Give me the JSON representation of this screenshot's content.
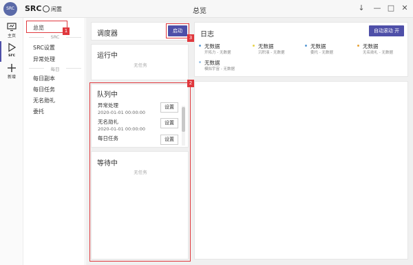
{
  "titlebar": {
    "logo_text": "SRC",
    "app_name": "SRC",
    "status": "闲置",
    "window_title": "总览",
    "buttons": {
      "pin": "↓",
      "minimize": "—",
      "maximize": "□",
      "close": "✕"
    }
  },
  "rail": {
    "items": [
      {
        "label": "主页",
        "icon": "monitor-icon"
      },
      {
        "label": "src",
        "icon": "play-icon"
      },
      {
        "label": "新增",
        "icon": "plus-icon"
      }
    ]
  },
  "menu": {
    "overview": "总览",
    "group_src": "SRC",
    "src_settings": "SRC设置",
    "error_handling": "异常处理",
    "group_daily": "每日",
    "daily_dungeon": "每日副本",
    "daily_tasks": "每日任务",
    "nameless_honor": "无名勋礼",
    "commission": "委托"
  },
  "scheduler": {
    "title": "调度器",
    "start_button": "启动"
  },
  "running": {
    "title": "运行中",
    "empty": "无任务"
  },
  "queue": {
    "title": "队列中",
    "tasks": [
      {
        "name": "异常处理",
        "time": "2020-01-01 00:00:00",
        "button": "设置"
      },
      {
        "name": "无名勋礼",
        "time": "2020-01-01 00:00:00",
        "button": "设置"
      },
      {
        "name": "每日任务",
        "time": "2020-01-01 00:00:00",
        "button": "设置"
      }
    ]
  },
  "waiting": {
    "title": "等待中",
    "empty": "无任务"
  },
  "log": {
    "title": "日志",
    "autoscroll_button": "自动滚动 开",
    "items": [
      {
        "title": "无数据",
        "sub": "开拓力 - 无数据",
        "color": "#5b9bd5"
      },
      {
        "title": "无数据",
        "sub": "沉积液 - 无数据",
        "color": "#e8d34a"
      },
      {
        "title": "无数据",
        "sub": "委托 - 无数据",
        "color": "#5b9bd5"
      },
      {
        "title": "无数据",
        "sub": "无名勋礼 - 无数据",
        "color": "#e8a43a"
      },
      {
        "title": "无数据",
        "sub": "模拟宇宙 - 无数据",
        "color": "#9ec5e8"
      }
    ]
  },
  "annotations": [
    "1",
    "2",
    "3"
  ],
  "colors": {
    "accent": "#4e4fa8",
    "annotation": "#e0383d"
  }
}
